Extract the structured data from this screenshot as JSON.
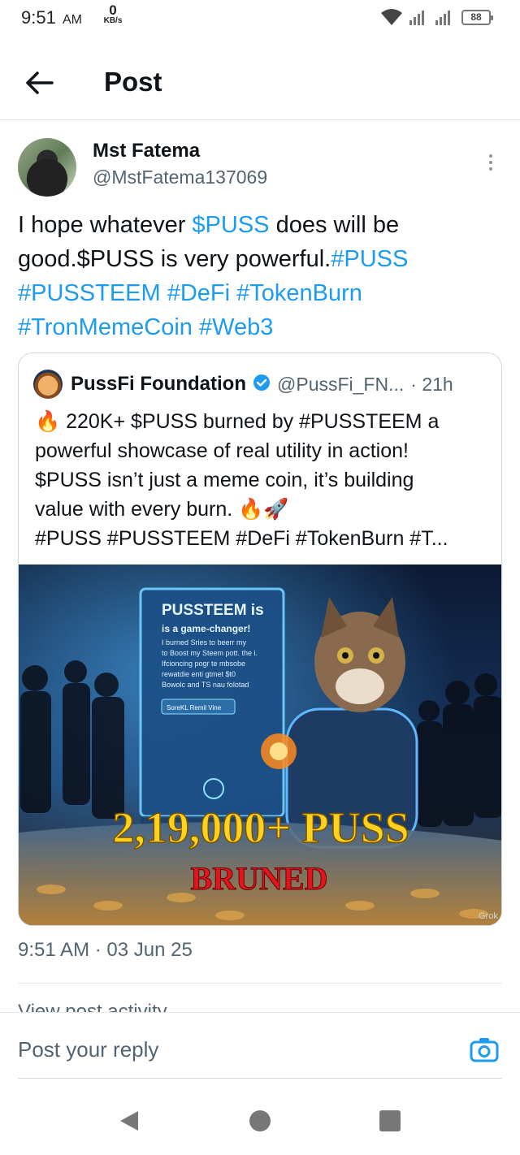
{
  "status_bar": {
    "time": "9:51",
    "time_suffix": "AM",
    "net_speed_value": "0",
    "net_speed_unit": "KB/s",
    "battery": "88"
  },
  "header": {
    "title": "Post",
    "back_icon": "arrow-left-icon"
  },
  "author": {
    "name": "Mst Fatema",
    "handle": "@MstFatema137069"
  },
  "post": {
    "seg1": "I hope whatever ",
    "cashtag1": "$PUSS",
    "seg2": " does will be good.$PUSS is very powerful.",
    "tag1": "#PUSS",
    "tag2": "#PUSSTEEM",
    "tag3": "#DeFi",
    "tag4": "#TokenBurn",
    "tag5": "#TronMemeCoin",
    "tag6": "#Web3",
    "timestamp": "9:51 AM · 03 Jun 25",
    "view_activity": "View post activity"
  },
  "quote": {
    "name": "PussFi Foundation",
    "handle": "@PussFi_FN...",
    "time": "· 21h",
    "line1": "🔥 220K+ $PUSS burned by #PUSSTEEM  a",
    "line2": "powerful showcase of real utility in action!",
    "line3": "$PUSS isn’t just a meme coin, it’s building",
    "line4": "value with every burn. 🔥🚀",
    "line5": "#PUSS #PUSSTEEM #DeFi #TokenBurn #T...",
    "image": {
      "screen_title": "PUSSTEEM is",
      "screen_sub": "is a game-changer!",
      "screen_l1": "I burned Sries to beerr my",
      "screen_l2": "to Boost my Steem pott. the i.",
      "screen_l3": "Ifcioncing pogr te mbsobe",
      "screen_l4": "rewatdie enti gtmet $t0",
      "screen_l5": "Bowolc and TS nau folotad",
      "screen_button": "SoreKL Remil Vine",
      "big_amount": "2,19,000+ PUSS",
      "burned": "BRUNED",
      "watermark": "Grok"
    }
  },
  "reply": {
    "placeholder": "Post your reply"
  },
  "colors": {
    "link": "#1d9bf0",
    "text": "#0f1419",
    "secondary": "#536471",
    "border": "#cfd9de"
  }
}
